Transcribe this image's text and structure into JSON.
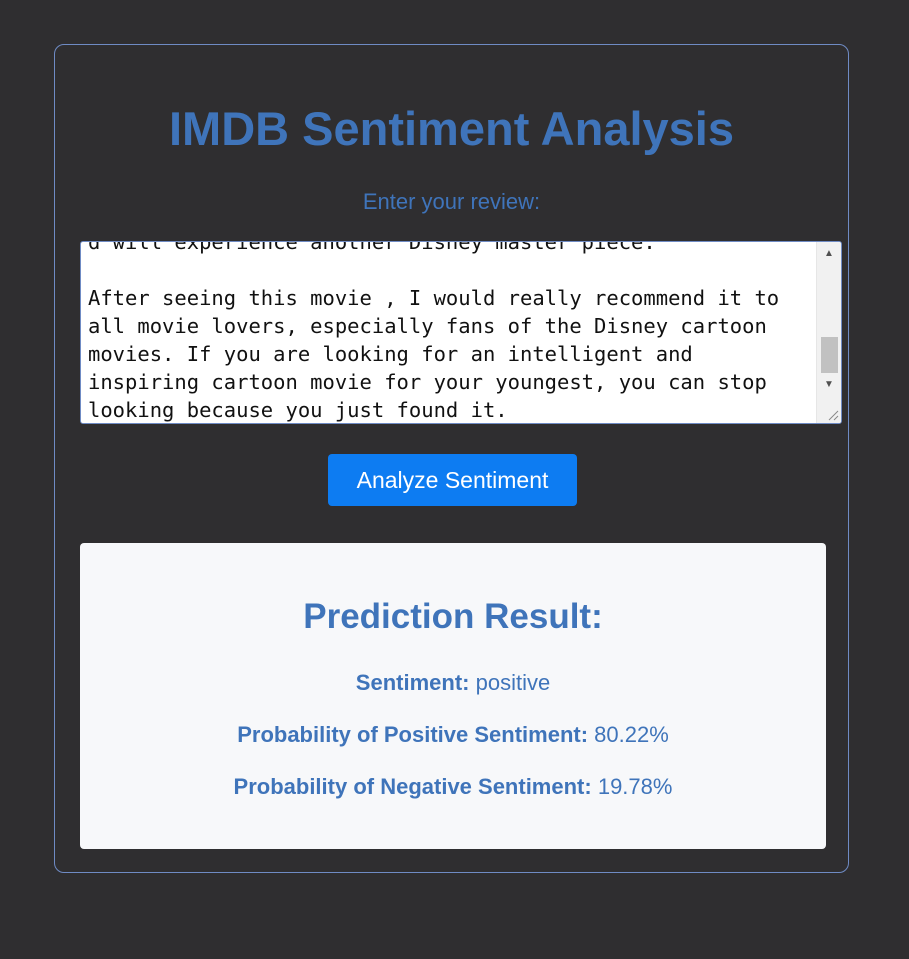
{
  "header": {
    "title": "IMDB Sentiment Analysis"
  },
  "form": {
    "label": "Enter your review:",
    "review_text": "d will experience another Disney master piece.\n\nAfter seeing this movie , I would really recommend it to all movie lovers, especially fans of the Disney cartoon movies. If you are looking for an intelligent and inspiring cartoon movie for your youngest, you can stop looking because you just found it.",
    "button_label": "Analyze Sentiment"
  },
  "result": {
    "title": "Prediction Result:",
    "sentiment_label": "Sentiment:",
    "sentiment_value": "positive",
    "positive_label": "Probability of Positive Sentiment:",
    "positive_value": "80.22%",
    "negative_label": "Probability of Negative Sentiment:",
    "negative_value": "19.78%"
  },
  "colors": {
    "background": "#2f2e30",
    "accent": "#3f74ba",
    "button": "#0d7cf2",
    "card": "#f7f8fa"
  },
  "icons": {
    "scroll_up": "scroll-up-arrow-icon",
    "scroll_down": "scroll-down-arrow-icon",
    "resize": "resize-grip-icon"
  }
}
